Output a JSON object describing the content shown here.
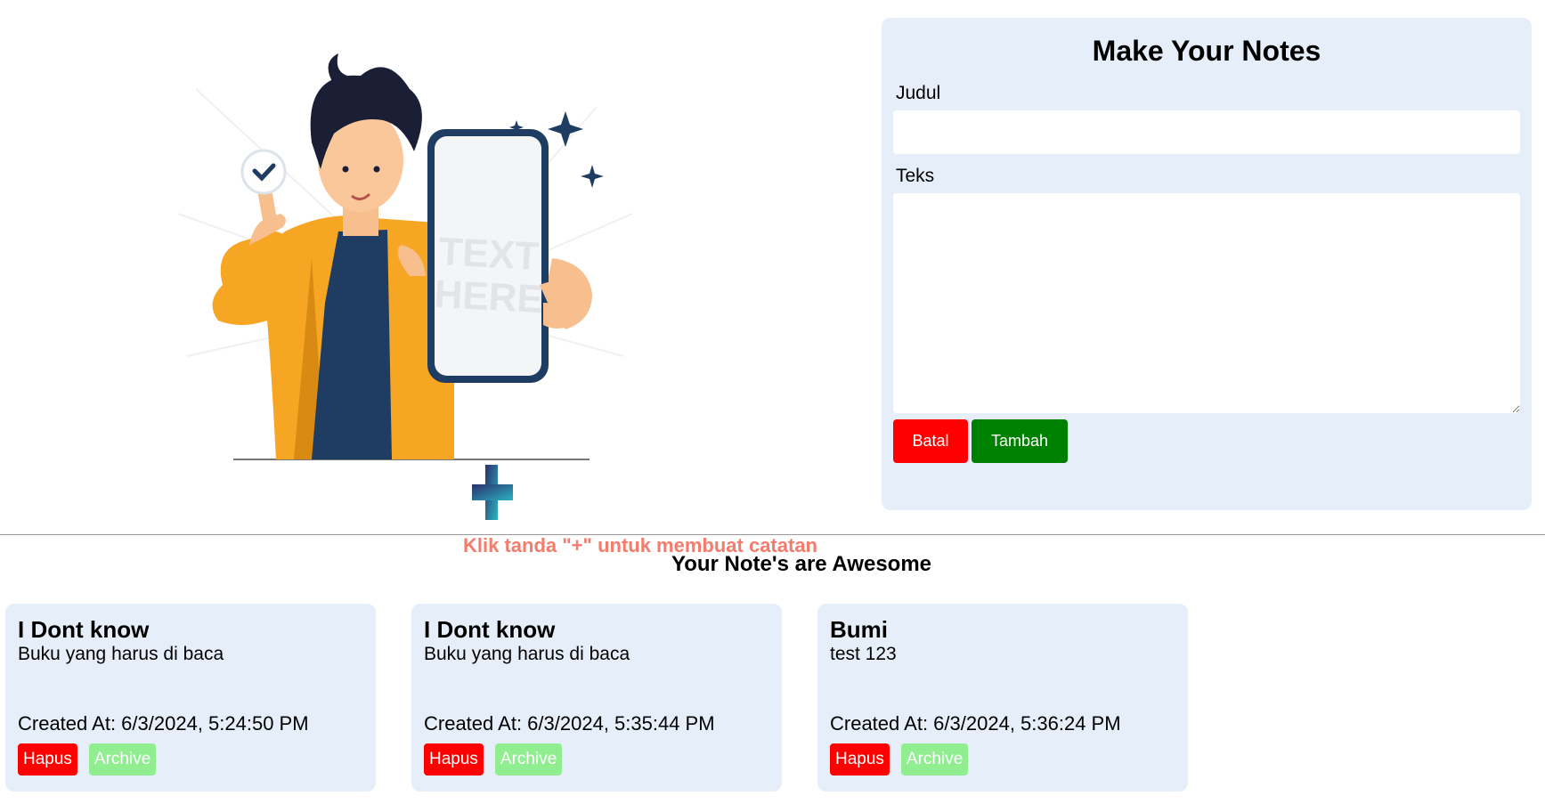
{
  "hero": {
    "hint": "Klik tanda \"+\" untuk membuat catatan",
    "phone_text": [
      "TEXT",
      "HERE"
    ]
  },
  "form": {
    "title": "Make Your Notes",
    "title_label": "Judul",
    "title_value": "",
    "text_label": "Teks",
    "text_value": "",
    "cancel_label": "Batal",
    "add_label": "Tambah"
  },
  "notes_section": {
    "heading": "Your Note's are Awesome",
    "notes": [
      {
        "title": "I Dont know",
        "body": "Buku yang harus di baca",
        "created": "Created At: 6/3/2024, 5:24:50 PM",
        "delete_label": "Hapus",
        "archive_label": "Archive"
      },
      {
        "title": "I Dont know",
        "body": "Buku yang harus di baca",
        "created": "Created At: 6/3/2024, 5:35:44 PM",
        "delete_label": "Hapus",
        "archive_label": "Archive"
      },
      {
        "title": "Bumi",
        "body": "test 123",
        "created": "Created At: 6/3/2024, 5:36:24 PM",
        "delete_label": "Hapus",
        "archive_label": "Archive"
      }
    ]
  },
  "colors": {
    "panel": "#e6eff9",
    "danger": "#ff0000",
    "success": "#008000",
    "archive": "#90ee90",
    "hint": "#f47c6c"
  }
}
